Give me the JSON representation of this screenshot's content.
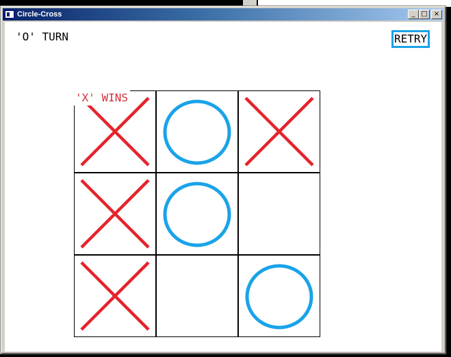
{
  "window": {
    "title": "Circle-Cross",
    "buttons": {
      "minimize": "_",
      "maximize": "□",
      "close": "×"
    }
  },
  "game": {
    "turn_text": "'O' TURN",
    "retry_label": "RETRY",
    "result_text": "'X' WINS",
    "board": [
      [
        "X",
        "O",
        "X"
      ],
      [
        "X",
        "O",
        ""
      ],
      [
        "X",
        "",
        "O"
      ]
    ]
  },
  "colors": {
    "x_mark": "#e5232c",
    "o_mark": "#1aa3e8",
    "result_text": "#d0313a",
    "retry_border": "#1aa3e8"
  },
  "icons": {
    "app": "window-icon"
  }
}
